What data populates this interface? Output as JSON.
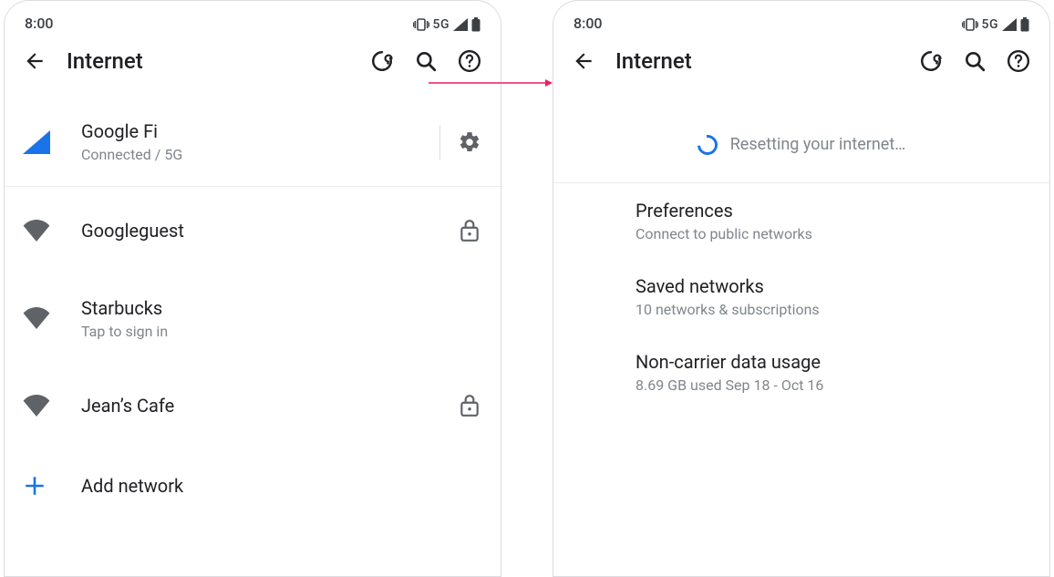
{
  "statusbar": {
    "time": "8:00",
    "network_label": "5G"
  },
  "appbar": {
    "title": "Internet"
  },
  "carrier": {
    "name": "Google Fi",
    "status": "Connected / 5G"
  },
  "wifi": [
    {
      "name": "Googleguest",
      "sub": "",
      "locked": true
    },
    {
      "name": "Starbucks",
      "sub": "Tap to sign in",
      "locked": false
    },
    {
      "name": "Jean’s Cafe",
      "sub": "",
      "locked": true
    }
  ],
  "add_network_label": "Add network",
  "resetting_label": "Resetting your internet…",
  "prefs": [
    {
      "title": "Preferences",
      "sub": "Connect to public networks"
    },
    {
      "title": "Saved networks",
      "sub": "10 networks & subscriptions"
    },
    {
      "title": "Non-carrier data usage",
      "sub": "8.69 GB used Sep 18 - Oct 16"
    }
  ]
}
